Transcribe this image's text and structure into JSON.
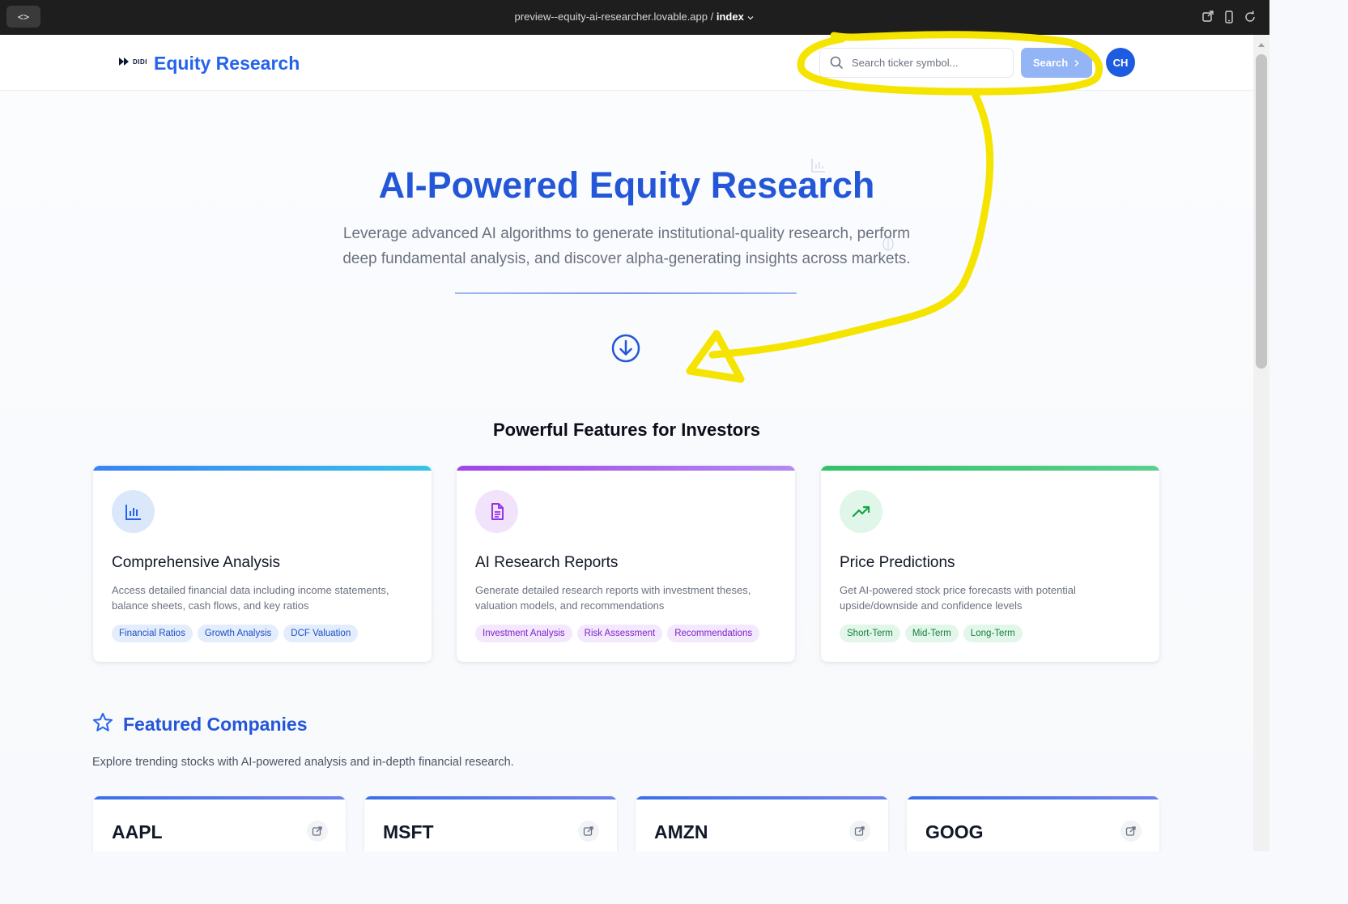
{
  "browser": {
    "url_host": "preview--equity-ai-researcher.lovable.app",
    "url_sep": " / ",
    "url_page": "index"
  },
  "header": {
    "logo_text": "DIDI",
    "brand": "Equity Research",
    "search_placeholder": "Search ticker symbol...",
    "search_button": "Search",
    "avatar_initials": "CH"
  },
  "hero": {
    "title": "AI-Powered Equity Research",
    "subtitle": "Leverage advanced AI algorithms to generate institutional-quality research, perform deep fundamental analysis, and discover alpha-generating insights across markets."
  },
  "features": {
    "title": "Powerful Features for Investors",
    "cards": [
      {
        "title": "Comprehensive Analysis",
        "description": "Access detailed financial data including income statements, balance sheets, cash flows, and key ratios",
        "tags": [
          "Financial Ratios",
          "Growth Analysis",
          "DCF Valuation"
        ],
        "icon": "bar-chart-icon",
        "accent": "#3b82f6"
      },
      {
        "title": "AI Research Reports",
        "description": "Generate detailed research reports with investment theses, valuation models, and recommendations",
        "tags": [
          "Investment Analysis",
          "Risk Assessment",
          "Recommendations"
        ],
        "icon": "document-icon",
        "accent": "#9333ea"
      },
      {
        "title": "Price Predictions",
        "description": "Get AI-powered stock price forecasts with potential upside/downside and confidence levels",
        "tags": [
          "Short-Term",
          "Mid-Term",
          "Long-Term"
        ],
        "icon": "trending-up-icon",
        "accent": "#16a34a"
      }
    ]
  },
  "featured_companies": {
    "title": "Featured Companies",
    "description": "Explore trending stocks with AI-powered analysis and in-depth financial research.",
    "companies": [
      "AAPL",
      "MSFT",
      "AMZN",
      "GOOG"
    ]
  },
  "annotation": {
    "color": "#f5e400"
  }
}
